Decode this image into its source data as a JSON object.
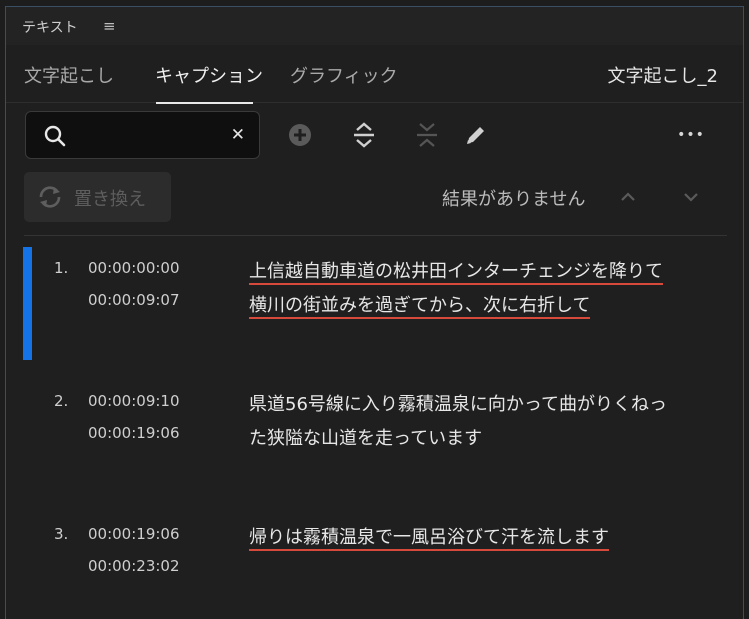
{
  "panel": {
    "title": "テキスト",
    "menu_glyph": "≡"
  },
  "tabs": {
    "items": [
      "文字起こし",
      "キャプション",
      "グラフィック"
    ],
    "active_index": 1,
    "sequence_name": "文字起こし_2"
  },
  "search": {
    "value": "",
    "placeholder": ""
  },
  "toolbar": {
    "icons": [
      "add-icon",
      "split-icon",
      "merge-icon",
      "pencil-icon",
      "more-icon"
    ],
    "more_label": "•••"
  },
  "replace": {
    "label": "置き換え",
    "icon": "replace-icon"
  },
  "results": {
    "text": "結果がありません"
  },
  "captions": [
    {
      "index": "1.",
      "in": "00:00:00:00",
      "out": "00:00:09:07",
      "lines": [
        "上信越自動車道の松井田インターチェンジを降りて",
        "横川の街並みを過ぎてから、次に右折して"
      ],
      "underlined": true,
      "selected": true
    },
    {
      "index": "2.",
      "in": "00:00:09:10",
      "out": "00:00:19:06",
      "lines": [
        "県道56号線に入り霧積温泉に向かって曲がりくねっ",
        "た狭隘な山道を走っています"
      ],
      "underlined": false,
      "selected": false
    },
    {
      "index": "3.",
      "in": "00:00:19:06",
      "out": "00:00:23:02",
      "lines": [
        "帰りは霧積温泉で一風呂浴びて汗を流します"
      ],
      "underlined": true,
      "selected": false
    }
  ],
  "colors": {
    "accent": "#1473e6",
    "error_underline": "#d64a3b"
  }
}
